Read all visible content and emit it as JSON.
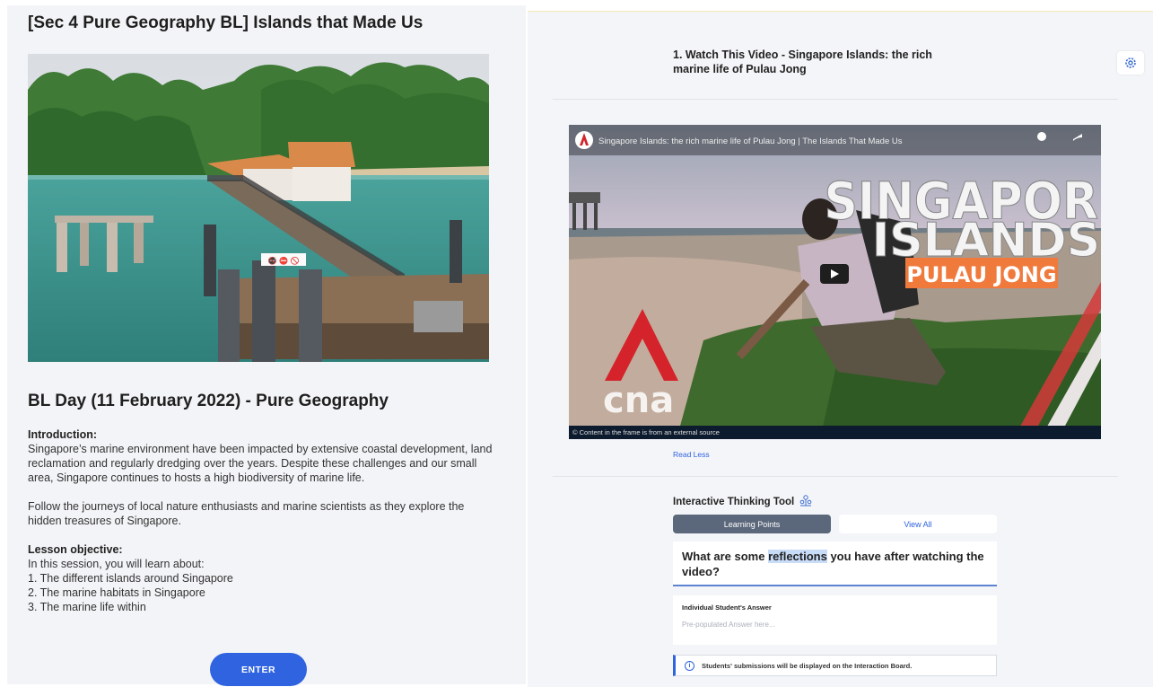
{
  "left": {
    "title": "[Sec 4 Pure Geography BL] Islands that Made Us",
    "subtitle": "BL Day (11 February 2022) - Pure Geography",
    "intro_heading": "Introduction:",
    "intro_p1": "Singapore’s marine environment have been impacted by extensive coastal development, land reclamation and regularly dredging over the years. Despite these challenges and our small area, Singapore continues to hosts a high biodiversity of marine life.",
    "intro_p2": "Follow the journeys of local nature enthusiasts and marine scientists as they explore the hidden treasures of Singapore.",
    "objective_heading": "Lesson objective:",
    "objective_intro": "In this session, you will learn about:",
    "objectives": [
      "1. The different islands around Singapore",
      "2. The marine habitats in Singapore",
      "3. The marine life within"
    ],
    "enter_label": "ENTER",
    "photo_icon": "jetty-photo",
    "photo_sign_text": "🚭 ⛔ 🚫"
  },
  "right": {
    "video_heading": "1. Watch This Video - Singapore Islands: the rich marine life of Pulau Jong",
    "settings_icon": "settings-gear-icon",
    "video": {
      "title_bar": "Singapore Islands: the rich marine life of Pulau Jong | The Islands That Made Us",
      "big_title_1": "SINGAPORE",
      "big_title_2": "ISLANDS",
      "banner": "PULAU JONG",
      "logo_text": "cna",
      "footer_note": "© Content in the frame is from an external source"
    },
    "read_less": "Read Less",
    "itt_title": "Interactive Thinking Tool",
    "tabs": [
      "Learning Points",
      "View All"
    ],
    "question_pre": "What are some ",
    "question_hl": "reflections",
    "question_post": " you have after watching the video?",
    "answer_label": "Individual Student's Answer",
    "answer_placeholder": "Pre-populated Answer here...",
    "info_text": "Students' submissions will be displayed on the Interaction Board.",
    "info_icon_glyph": "i"
  },
  "colors": {
    "accent_blue": "#2f63e0",
    "active_tab": "#5b677b",
    "cna_red": "#d4232a",
    "banner_orange": "#f07a3c"
  }
}
